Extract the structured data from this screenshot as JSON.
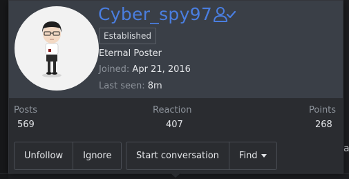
{
  "profile": {
    "username": "Cyber_spy97",
    "badge": "Established",
    "user_title": "Eternal Poster",
    "joined_label": "Joined:",
    "joined_value": "Apr 21, 2016",
    "last_seen_label": "Last seen:",
    "last_seen_value": "8m",
    "username_color": "#4a7ee0",
    "follow_icon": "user-check-icon"
  },
  "stats": [
    {
      "label": "Posts",
      "value": "569"
    },
    {
      "label": "Reaction",
      "value": "407"
    },
    {
      "label": "Points",
      "value": "268"
    }
  ],
  "actions": {
    "unfollow": "Unfollow",
    "ignore": "Ignore",
    "start_conversation": "Start conversation",
    "find": "Find"
  }
}
